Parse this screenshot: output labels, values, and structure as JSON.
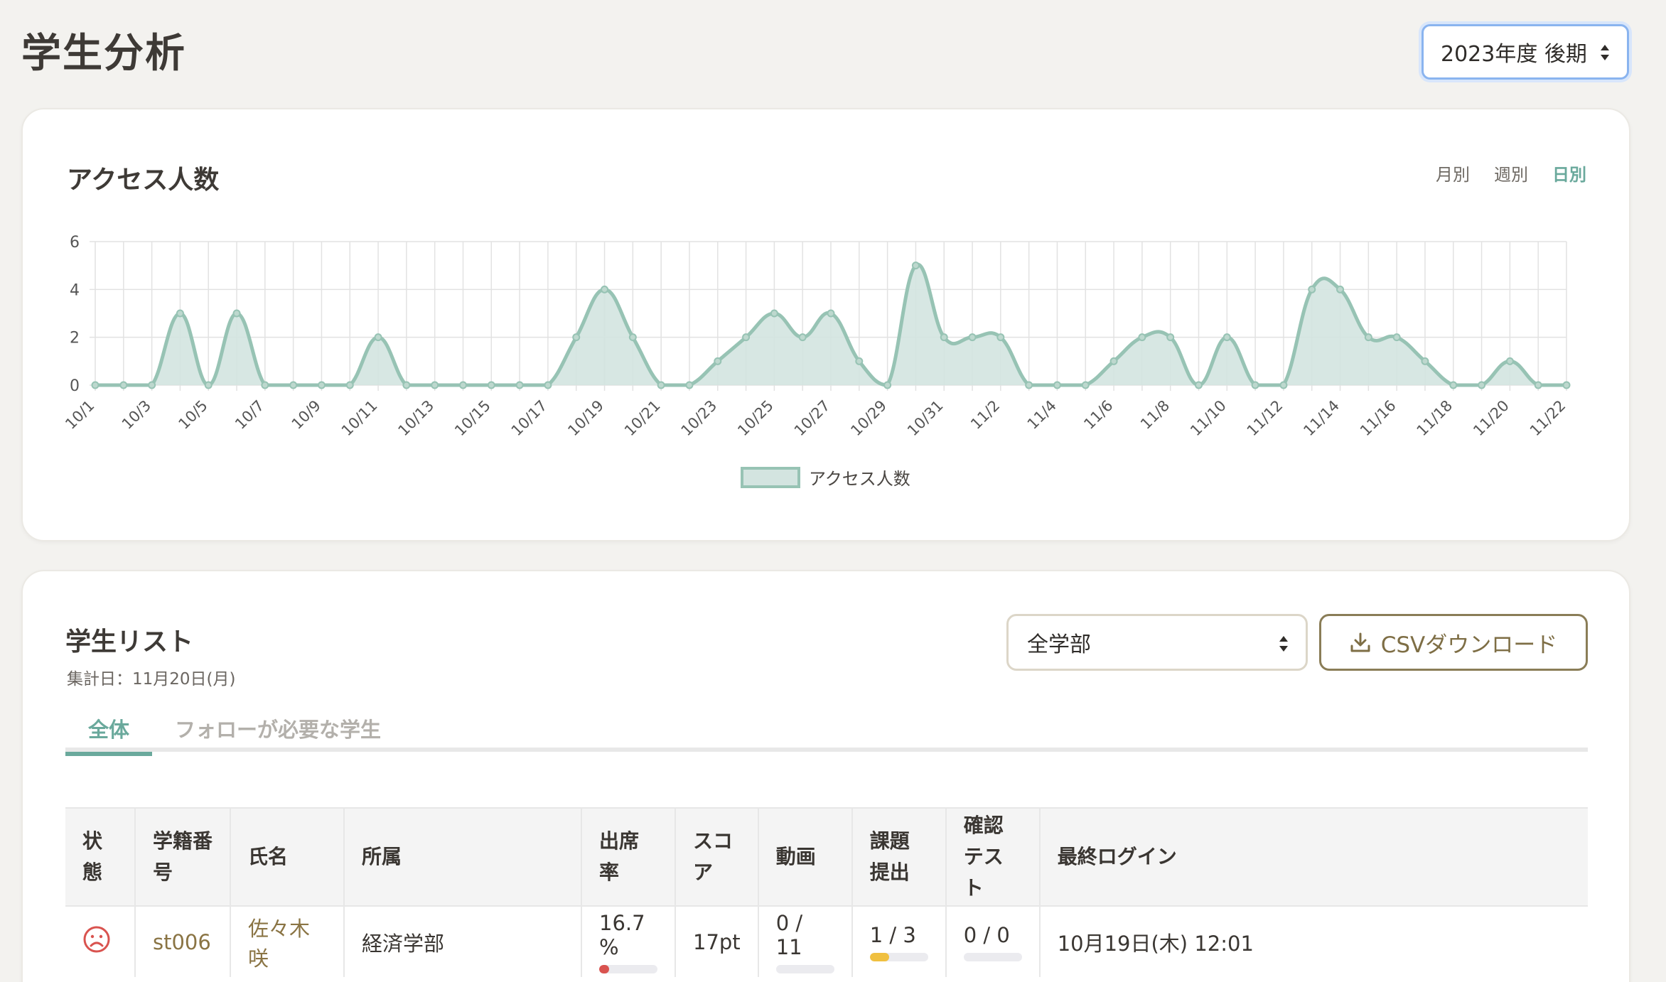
{
  "page": {
    "title": "学生分析"
  },
  "term_select": {
    "value": "2023年度 後期"
  },
  "access_chart": {
    "title": "アクセス人数",
    "period_tabs": [
      {
        "label": "月別",
        "active": false
      },
      {
        "label": "週別",
        "active": false
      },
      {
        "label": "日別",
        "active": true
      }
    ],
    "legend_label": "アクセス人数"
  },
  "chart_data": {
    "type": "area",
    "categories": [
      "10/1",
      "10/2",
      "10/3",
      "10/4",
      "10/5",
      "10/6",
      "10/7",
      "10/8",
      "10/9",
      "10/10",
      "10/11",
      "10/12",
      "10/13",
      "10/14",
      "10/15",
      "10/16",
      "10/17",
      "10/18",
      "10/19",
      "10/20",
      "10/21",
      "10/22",
      "10/23",
      "10/24",
      "10/25",
      "10/26",
      "10/27",
      "10/28",
      "10/29",
      "10/30",
      "10/31",
      "11/1",
      "11/2",
      "11/3",
      "11/4",
      "11/5",
      "11/6",
      "11/7",
      "11/8",
      "11/9",
      "11/10",
      "11/11",
      "11/12",
      "11/13",
      "11/14",
      "11/15",
      "11/16",
      "11/17",
      "11/18",
      "11/19",
      "11/20",
      "11/21",
      "11/22"
    ],
    "tick_labels": [
      "10/1",
      "10/3",
      "10/5",
      "10/7",
      "10/9",
      "10/11",
      "10/13",
      "10/15",
      "10/17",
      "10/19",
      "10/21",
      "10/23",
      "10/25",
      "10/27",
      "10/29",
      "10/31",
      "11/2",
      "11/4",
      "11/6",
      "11/8",
      "11/10",
      "11/12",
      "11/14",
      "11/16",
      "11/18",
      "11/20",
      "11/22"
    ],
    "series": [
      {
        "name": "アクセス人数",
        "values": [
          0,
          0,
          0,
          3,
          0,
          3,
          0,
          0,
          0,
          0,
          2,
          0,
          0,
          0,
          0,
          0,
          0,
          2,
          4,
          2,
          0,
          0,
          1,
          2,
          3,
          2,
          3,
          1,
          0,
          5,
          2,
          2,
          2,
          0,
          0,
          0,
          1,
          2,
          2,
          0,
          2,
          0,
          0,
          4,
          4,
          2,
          2,
          1,
          0,
          0,
          1,
          0,
          0
        ]
      }
    ],
    "ylim": [
      0,
      6
    ],
    "yticks": [
      0,
      2,
      4,
      6
    ],
    "grid": true,
    "legend": "bottom",
    "colors": {
      "line": "#97c3b4",
      "fill": "#d3e4e0",
      "grid": "#e2e2e2"
    }
  },
  "student_list": {
    "title": "学生リスト",
    "date_label": "集計日：11月20日(月)",
    "dept_select": {
      "value": "全学部"
    },
    "csv_button": "CSVダウンロード",
    "tabs": [
      {
        "label": "全体",
        "active": true
      },
      {
        "label": "フォローが必要な学生",
        "active": false
      }
    ],
    "columns": [
      "状態",
      "学籍番号",
      "氏名",
      "所属",
      "出席率",
      "スコア",
      "動画",
      "課題提出",
      "確認テスト",
      "最終ログイン"
    ],
    "rows": [
      {
        "status_icon": "sad-face-icon",
        "student_id": "st006",
        "name": "佐々木 咲",
        "department": "経済学部",
        "attendance": "16.7 %",
        "attendance_ratio": 0.167,
        "score": "17pt",
        "video": "0 / 11",
        "video_ratio": 0,
        "assignment": "1 / 3",
        "assignment_ratio": 0.333,
        "quiz": "0 / 0",
        "quiz_ratio": 0,
        "last_login": "10月19日(木) 12:01"
      }
    ]
  },
  "colors": {
    "accent": "#6aa99c",
    "brand": "#8a7444",
    "danger": "#d9534f",
    "warning": "#f0c040",
    "focus": "#8ab4ef"
  }
}
